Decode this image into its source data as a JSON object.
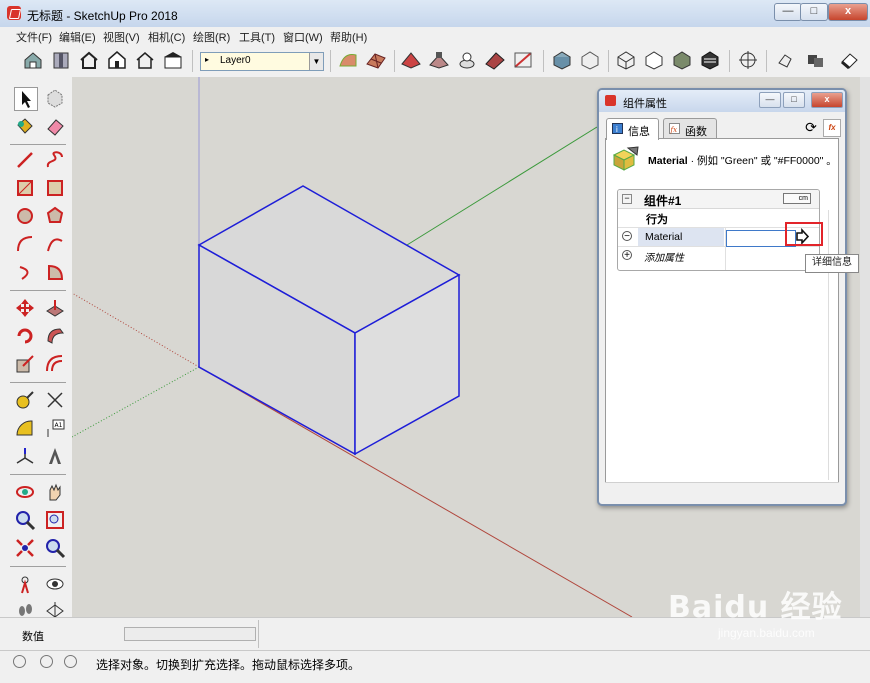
{
  "window": {
    "title": "无标题 - SketchUp Pro 2018",
    "min": "—",
    "max": "□",
    "close": "x"
  },
  "menu": [
    "文件(F)",
    "编辑(E)",
    "视图(V)",
    "相机(C)",
    "绘图(R)",
    "工具(T)",
    "窗口(W)",
    "帮助(H)"
  ],
  "layer": {
    "name": "Layer0"
  },
  "dialog": {
    "title": "组件属性",
    "tabs": {
      "info": "信息",
      "functions": "函数"
    },
    "hint_bold": "Material",
    "hint_rest": " · 例如 \"Green\" 或 \"#FF0000\" 。",
    "component_name": "组件#1",
    "units": "cm",
    "section_label": "行为",
    "attribute_name": "Material",
    "attribute_value": "",
    "add_attribute": "添加属性",
    "tooltip": "详细信息",
    "fx": "fx"
  },
  "measurements": {
    "label": "数值",
    "value": ""
  },
  "status": {
    "text": "选择对象。切换到扩充选择。拖动鼠标选择多项。"
  },
  "watermark": {
    "brand": "Baidu 经验",
    "url": "jingyan.baidu.com"
  },
  "colors": {
    "axis_red": "#b0463c",
    "axis_green": "#3c9a3c",
    "axis_blue": "#4a4acc",
    "box_edges": "#1e1ed8",
    "highlight": "#e2242a"
  }
}
